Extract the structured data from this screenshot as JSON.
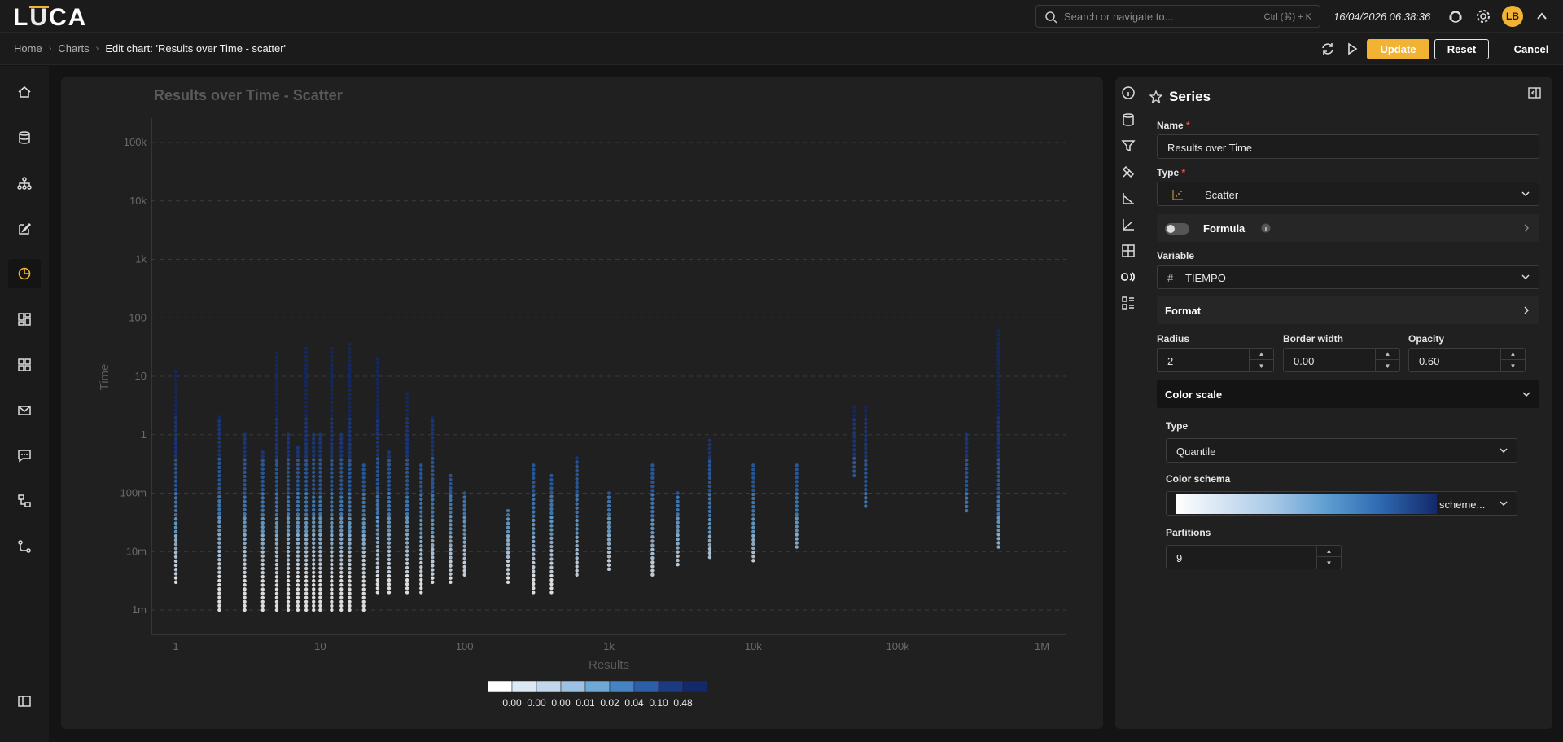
{
  "app": {
    "logo": "LUCA"
  },
  "topbar": {
    "search_placeholder": "Search or navigate to...",
    "shortcut": "Ctrl (⌘) + K",
    "datetime": "16/04/2026 06:38:36",
    "avatar_initials": "LB",
    "accent": "#f2b233"
  },
  "breadcrumb": {
    "items": [
      "Home",
      "Charts"
    ],
    "current": "Edit chart: 'Results over Time - scatter'"
  },
  "actions": {
    "update": "Update",
    "reset": "Reset",
    "cancel": "Cancel"
  },
  "nav": {
    "items": [
      "home-icon",
      "database-icon",
      "hierarchy-icon",
      "edit-icon",
      "chart-icon",
      "dashboard-icon",
      "grid-icon",
      "mail-icon",
      "chat-icon",
      "flow-icon",
      "path-icon",
      "collapse-icon"
    ],
    "active": 4
  },
  "series_panel": {
    "title": "Series",
    "name_label": "Name",
    "name_value": "Results over Time",
    "type_label": "Type",
    "type_value": "Scatter",
    "formula_label": "Formula",
    "variable_label": "Variable",
    "variable_value": "TIEMPO",
    "format_label": "Format",
    "radius_label": "Radius",
    "radius_value": "2",
    "border_label": "Border width",
    "border_value": "0.00",
    "opacity_label": "Opacity",
    "opacity_value": "0.60",
    "color_scale_label": "Color scale",
    "cs_type_label": "Type",
    "cs_type_value": "Quantile",
    "schema_label": "Color schema",
    "schema_value": "scheme...",
    "partitions_label": "Partitions",
    "partitions_value": "9"
  },
  "chart_data": {
    "type": "scatter",
    "title": "Results over Time - Scatter",
    "xlabel": "Results",
    "ylabel": "Time",
    "x_scale": "log",
    "y_scale": "log",
    "xlim": [
      1,
      1000000
    ],
    "ylim": [
      0.001,
      100000
    ],
    "x_ticks": [
      "1",
      "10",
      "100",
      "1k",
      "10k",
      "100k",
      "1M"
    ],
    "y_ticks": [
      "1m",
      "10m",
      "100m",
      "1",
      "10",
      "100",
      "1k",
      "10k",
      "100k"
    ],
    "grid": "horizontal-dashed",
    "legend": {
      "placement": "bottom-center",
      "labels": [
        "0.00",
        "0.00",
        "0.00",
        "0.01",
        "0.02",
        "0.04",
        "0.10",
        "0.48"
      ],
      "colors": [
        "#ffffff",
        "#dde8f5",
        "#c2d7ec",
        "#9cc1e2",
        "#6ea8d6",
        "#4583c2",
        "#2c5fa8",
        "#1b3a82",
        "#13296a"
      ]
    },
    "columns": [
      {
        "x": 1,
        "ymin": 0.003,
        "ymax": 12
      },
      {
        "x": 2,
        "ymin": 0.001,
        "ymax": 2
      },
      {
        "x": 3,
        "ymin": 0.001,
        "ymax": 1
      },
      {
        "x": 4,
        "ymin": 0.001,
        "ymax": 0.5
      },
      {
        "x": 5,
        "ymin": 0.001,
        "ymax": 25
      },
      {
        "x": 6,
        "ymin": 0.001,
        "ymax": 1
      },
      {
        "x": 7,
        "ymin": 0.001,
        "ymax": 0.6
      },
      {
        "x": 8,
        "ymin": 0.001,
        "ymax": 30
      },
      {
        "x": 9,
        "ymin": 0.001,
        "ymax": 1
      },
      {
        "x": 10,
        "ymin": 0.001,
        "ymax": 1
      },
      {
        "x": 12,
        "ymin": 0.001,
        "ymax": 30
      },
      {
        "x": 14,
        "ymin": 0.001,
        "ymax": 1
      },
      {
        "x": 16,
        "ymin": 0.001,
        "ymax": 35
      },
      {
        "x": 20,
        "ymin": 0.001,
        "ymax": 0.3
      },
      {
        "x": 25,
        "ymin": 0.002,
        "ymax": 20
      },
      {
        "x": 30,
        "ymin": 0.002,
        "ymax": 0.5
      },
      {
        "x": 40,
        "ymin": 0.002,
        "ymax": 5
      },
      {
        "x": 50,
        "ymin": 0.002,
        "ymax": 0.3
      },
      {
        "x": 60,
        "ymin": 0.003,
        "ymax": 2
      },
      {
        "x": 80,
        "ymin": 0.003,
        "ymax": 0.2
      },
      {
        "x": 100,
        "ymin": 0.004,
        "ymax": 0.1
      },
      {
        "x": 200,
        "ymin": 0.003,
        "ymax": 0.05
      },
      {
        "x": 300,
        "ymin": 0.002,
        "ymax": 0.3
      },
      {
        "x": 400,
        "ymin": 0.002,
        "ymax": 0.2
      },
      {
        "x": 600,
        "ymin": 0.004,
        "ymax": 0.4
      },
      {
        "x": 1000,
        "ymin": 0.005,
        "ymax": 0.1
      },
      {
        "x": 2000,
        "ymin": 0.004,
        "ymax": 0.3
      },
      {
        "x": 3000,
        "ymin": 0.006,
        "ymax": 0.1
      },
      {
        "x": 5000,
        "ymin": 0.008,
        "ymax": 0.8
      },
      {
        "x": 10000,
        "ymin": 0.007,
        "ymax": 0.3
      },
      {
        "x": 20000,
        "ymin": 0.012,
        "ymax": 0.3
      },
      {
        "x": 50000,
        "ymin": 0.2,
        "ymax": 3
      },
      {
        "x": 60000,
        "ymin": 0.06,
        "ymax": 3
      },
      {
        "x": 300000,
        "ymin": 0.05,
        "ymax": 1
      },
      {
        "x": 500000,
        "ymin": 0.012,
        "ymax": 60
      }
    ]
  }
}
